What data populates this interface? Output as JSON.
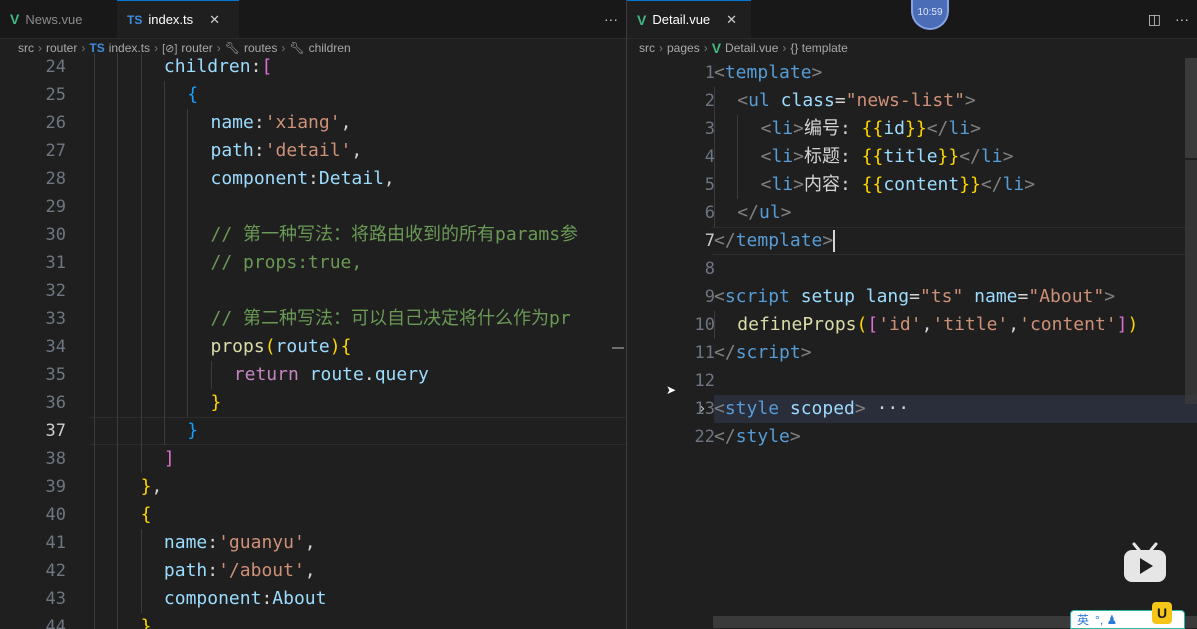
{
  "left": {
    "tabs": [
      {
        "icon": "vue-file-icon",
        "label": "News.vue",
        "active": false
      },
      {
        "icon": "ts-file-icon",
        "label": "index.ts",
        "active": true
      }
    ],
    "more_label": "···",
    "breadcrumb": [
      "src",
      "router",
      "index.ts",
      "router",
      "routes",
      "children"
    ],
    "lines": [
      {
        "n": "24",
        "indent": 3,
        "tokens": [
          [
            "k-prop",
            "children"
          ],
          [
            "k-plain",
            ":"
          ],
          [
            "k-brace2",
            "["
          ]
        ]
      },
      {
        "n": "25",
        "indent": 4,
        "tokens": [
          [
            "k-brace3",
            "{"
          ]
        ]
      },
      {
        "n": "26",
        "indent": 5,
        "tokens": [
          [
            "k-prop",
            "name"
          ],
          [
            "k-plain",
            ":"
          ],
          [
            "k-str",
            "'xiang'"
          ],
          [
            "k-plain",
            ","
          ]
        ]
      },
      {
        "n": "27",
        "indent": 5,
        "tokens": [
          [
            "k-prop",
            "path"
          ],
          [
            "k-plain",
            ":"
          ],
          [
            "k-str",
            "'detail'"
          ],
          [
            "k-plain",
            ","
          ]
        ]
      },
      {
        "n": "28",
        "indent": 5,
        "tokens": [
          [
            "k-prop",
            "component"
          ],
          [
            "k-plain",
            ":"
          ],
          [
            "k-prop",
            "Detail"
          ],
          [
            "k-plain",
            ","
          ]
        ]
      },
      {
        "n": "29",
        "indent": 5,
        "tokens": []
      },
      {
        "n": "30",
        "indent": 5,
        "tokens": [
          [
            "k-cmt",
            "// 第一种写法：将路由收到的所有params参"
          ]
        ]
      },
      {
        "n": "31",
        "indent": 5,
        "tokens": [
          [
            "k-cmt",
            "// props:true,"
          ]
        ]
      },
      {
        "n": "32",
        "indent": 5,
        "tokens": []
      },
      {
        "n": "33",
        "indent": 5,
        "tokens": [
          [
            "k-cmt",
            "// 第二种写法：可以自己决定将什么作为pr"
          ]
        ]
      },
      {
        "n": "34",
        "indent": 5,
        "tokens": [
          [
            "k-fn",
            "props"
          ],
          [
            "k-brace1",
            "("
          ],
          [
            "k-prop",
            "route"
          ],
          [
            "k-brace1",
            ")"
          ],
          [
            "k-brace1",
            "{"
          ]
        ]
      },
      {
        "n": "35",
        "indent": 6,
        "tokens": [
          [
            "k-kw",
            "return"
          ],
          [
            "k-plain",
            " "
          ],
          [
            "k-prop",
            "route"
          ],
          [
            "k-plain",
            "."
          ],
          [
            "k-prop",
            "query"
          ]
        ]
      },
      {
        "n": "36",
        "indent": 5,
        "tokens": [
          [
            "k-brace1",
            "}"
          ]
        ]
      },
      {
        "n": "37",
        "indent": 4,
        "tokens": [
          [
            "k-brace3",
            "}"
          ]
        ],
        "current": true
      },
      {
        "n": "38",
        "indent": 3,
        "tokens": [
          [
            "k-brace2",
            "]"
          ]
        ]
      },
      {
        "n": "39",
        "indent": 2,
        "tokens": [
          [
            "k-brace1",
            "}"
          ],
          [
            "k-plain",
            ","
          ]
        ]
      },
      {
        "n": "40",
        "indent": 2,
        "tokens": [
          [
            "k-brace1",
            "{"
          ]
        ]
      },
      {
        "n": "41",
        "indent": 3,
        "tokens": [
          [
            "k-prop",
            "name"
          ],
          [
            "k-plain",
            ":"
          ],
          [
            "k-str",
            "'guanyu'"
          ],
          [
            "k-plain",
            ","
          ]
        ]
      },
      {
        "n": "42",
        "indent": 3,
        "tokens": [
          [
            "k-prop",
            "path"
          ],
          [
            "k-plain",
            ":"
          ],
          [
            "k-str",
            "'/about'"
          ],
          [
            "k-plain",
            ","
          ]
        ]
      },
      {
        "n": "43",
        "indent": 3,
        "tokens": [
          [
            "k-prop",
            "component"
          ],
          [
            "k-plain",
            ":"
          ],
          [
            "k-prop",
            "About"
          ]
        ]
      },
      {
        "n": "44",
        "indent": 2,
        "tokens": [
          [
            "k-brace1",
            "}"
          ]
        ]
      }
    ]
  },
  "right": {
    "tabs": [
      {
        "icon": "vue-file-icon",
        "label": "Detail.vue",
        "active": true
      }
    ],
    "split_icon": "split-editor-icon",
    "more_label": "···",
    "breadcrumb": [
      "src",
      "pages",
      "Detail.vue",
      "{} template"
    ],
    "lines": [
      {
        "n": "1",
        "indent": 0,
        "tokens": [
          [
            "k-punct",
            "<"
          ],
          [
            "k-tag",
            "template"
          ],
          [
            "k-punct",
            ">"
          ]
        ]
      },
      {
        "n": "2",
        "indent": 1,
        "tokens": [
          [
            "k-punct",
            "<"
          ],
          [
            "k-tag",
            "ul"
          ],
          [
            "k-plain",
            " "
          ],
          [
            "k-attr",
            "class"
          ],
          [
            "k-plain",
            "="
          ],
          [
            "k-str",
            "\"news-list\""
          ],
          [
            "k-punct",
            ">"
          ]
        ]
      },
      {
        "n": "3",
        "indent": 2,
        "tokens": [
          [
            "k-punct",
            "<"
          ],
          [
            "k-tag",
            "li"
          ],
          [
            "k-punct",
            ">"
          ],
          [
            "k-plain",
            "编号: "
          ],
          [
            "k-brace1",
            "{{"
          ],
          [
            "k-prop",
            "id"
          ],
          [
            "k-brace1",
            "}}"
          ],
          [
            "k-punct",
            "</"
          ],
          [
            "k-tag",
            "li"
          ],
          [
            "k-punct",
            ">"
          ]
        ]
      },
      {
        "n": "4",
        "indent": 2,
        "tokens": [
          [
            "k-punct",
            "<"
          ],
          [
            "k-tag",
            "li"
          ],
          [
            "k-punct",
            ">"
          ],
          [
            "k-plain",
            "标题: "
          ],
          [
            "k-brace1",
            "{{"
          ],
          [
            "k-prop",
            "title"
          ],
          [
            "k-brace1",
            "}}"
          ],
          [
            "k-punct",
            "</"
          ],
          [
            "k-tag",
            "li"
          ],
          [
            "k-punct",
            ">"
          ]
        ]
      },
      {
        "n": "5",
        "indent": 2,
        "tokens": [
          [
            "k-punct",
            "<"
          ],
          [
            "k-tag",
            "li"
          ],
          [
            "k-punct",
            ">"
          ],
          [
            "k-plain",
            "内容: "
          ],
          [
            "k-brace1",
            "{{"
          ],
          [
            "k-prop",
            "content"
          ],
          [
            "k-brace1",
            "}}"
          ],
          [
            "k-punct",
            "</"
          ],
          [
            "k-tag",
            "li"
          ],
          [
            "k-punct",
            ">"
          ]
        ]
      },
      {
        "n": "6",
        "indent": 1,
        "tokens": [
          [
            "k-punct",
            "</"
          ],
          [
            "k-tag",
            "ul"
          ],
          [
            "k-punct",
            ">"
          ]
        ]
      },
      {
        "n": "7",
        "indent": 0,
        "tokens": [
          [
            "k-punct",
            "</"
          ],
          [
            "k-tag",
            "template"
          ],
          [
            "k-punct",
            ">"
          ]
        ],
        "current": true,
        "cursor": true
      },
      {
        "n": "8",
        "indent": 0,
        "tokens": []
      },
      {
        "n": "9",
        "indent": 0,
        "tokens": [
          [
            "k-punct",
            "<"
          ],
          [
            "k-tag",
            "script"
          ],
          [
            "k-plain",
            " "
          ],
          [
            "k-attr",
            "setup"
          ],
          [
            "k-plain",
            " "
          ],
          [
            "k-attr",
            "lang"
          ],
          [
            "k-plain",
            "="
          ],
          [
            "k-str",
            "\"ts\""
          ],
          [
            "k-plain",
            " "
          ],
          [
            "k-attr",
            "name"
          ],
          [
            "k-plain",
            "="
          ],
          [
            "k-str",
            "\"About\""
          ],
          [
            "k-punct",
            ">"
          ]
        ]
      },
      {
        "n": "10",
        "indent": 1,
        "tokens": [
          [
            "k-fn",
            "defineProps"
          ],
          [
            "k-brace1",
            "("
          ],
          [
            "k-brace2",
            "["
          ],
          [
            "k-str",
            "'id'"
          ],
          [
            "k-plain",
            ","
          ],
          [
            "k-str",
            "'title'"
          ],
          [
            "k-plain",
            ","
          ],
          [
            "k-str",
            "'content'"
          ],
          [
            "k-brace2",
            "]"
          ],
          [
            "k-brace1",
            ")"
          ]
        ]
      },
      {
        "n": "11",
        "indent": 0,
        "tokens": [
          [
            "k-punct",
            "</"
          ],
          [
            "k-tag",
            "script"
          ],
          [
            "k-punct",
            ">"
          ]
        ]
      },
      {
        "n": "12",
        "indent": 0,
        "tokens": []
      },
      {
        "n": "13",
        "indent": 0,
        "tokens": [
          [
            "k-punct",
            "<"
          ],
          [
            "k-tag",
            "style"
          ],
          [
            "k-plain",
            " "
          ],
          [
            "k-attr",
            "scoped"
          ],
          [
            "k-punct",
            ">"
          ],
          [
            "k-plain",
            " ···"
          ]
        ],
        "folded": true
      },
      {
        "n": "22",
        "indent": 0,
        "tokens": [
          [
            "k-punct",
            "</"
          ],
          [
            "k-tag",
            "style"
          ],
          [
            "k-punct",
            ">"
          ]
        ]
      }
    ]
  },
  "overlay": {
    "clock": "10:59",
    "ime_label": "英",
    "ime_extra": "°, ♟",
    "ime_badge": "U"
  }
}
